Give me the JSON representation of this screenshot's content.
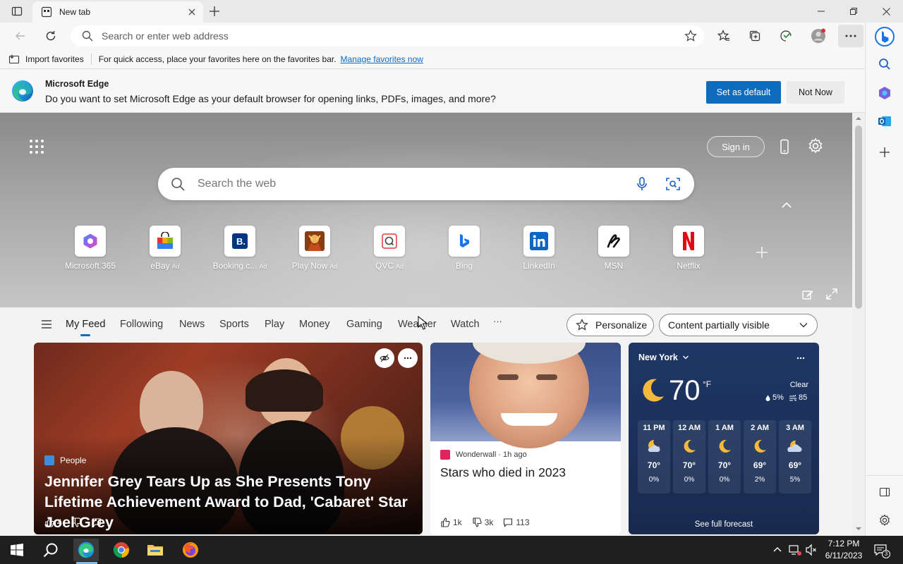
{
  "browser": {
    "tab_title": "New tab",
    "address_placeholder": "Search or enter web address",
    "favorites_bar": {
      "import_label": "Import favorites",
      "message": "For quick access, place your favorites here on the favorites bar.",
      "manage_link": "Manage favorites now"
    },
    "infobar": {
      "title": "Microsoft Edge",
      "message": "Do you want to set Microsoft Edge as your default browser for opening links, PDFs, images, and more?",
      "primary_button": "Set as default",
      "secondary_button": "Not Now"
    }
  },
  "ntp": {
    "signin_label": "Sign in",
    "search_placeholder": "Search the web",
    "quick_links": [
      {
        "label": "Microsoft 365",
        "ad": ""
      },
      {
        "label": "eBay",
        "ad": "Ad"
      },
      {
        "label": "Booking.c...",
        "ad": "Ad"
      },
      {
        "label": "Play Now",
        "ad": "Ad"
      },
      {
        "label": "QVC",
        "ad": "Ad"
      },
      {
        "label": "Bing",
        "ad": ""
      },
      {
        "label": "LinkedIn",
        "ad": ""
      },
      {
        "label": "MSN",
        "ad": ""
      },
      {
        "label": "Netflix",
        "ad": ""
      }
    ],
    "feed_nav": [
      "My Feed",
      "Following",
      "News",
      "Sports",
      "Play",
      "Money",
      "Gaming",
      "Weather",
      "Watch"
    ],
    "more_label": "···",
    "personalize_label": "Personalize",
    "content_visibility_label": "Content partially visible"
  },
  "cards": {
    "main": {
      "source": "People",
      "headline": "Jennifer Grey Tears Up as She Presents Tony Lifetime Achievement Award to Dad, 'Cabaret' Star Joel Grey",
      "likes": "4"
    },
    "second": {
      "source": "Wonderwall · 1h ago",
      "headline": "Stars who died in 2023",
      "likes": "1k",
      "dislikes": "3k",
      "comments": "113"
    }
  },
  "weather": {
    "city": "New York",
    "temp": "70",
    "unit": "°F",
    "condition": "Clear",
    "precip": "5%",
    "aqi": "85",
    "hours": [
      {
        "time": "11 PM",
        "temp": "70°",
        "precip": "0%",
        "icon": "partly-cloudy-night-icon"
      },
      {
        "time": "12 AM",
        "temp": "70°",
        "precip": "0%",
        "icon": "moon-icon"
      },
      {
        "time": "1 AM",
        "temp": "70°",
        "precip": "0%",
        "icon": "moon-icon"
      },
      {
        "time": "2 AM",
        "temp": "69°",
        "precip": "2%",
        "icon": "moon-icon"
      },
      {
        "time": "3 AM",
        "temp": "69°",
        "precip": "5%",
        "icon": "cloudy-night-icon"
      }
    ],
    "forecast_link": "See full forecast"
  },
  "taskbar": {
    "time": "7:12 PM",
    "date": "6/11/2023",
    "notification_count": "3"
  },
  "colors": {
    "accent": "#0f6cbd",
    "weather_bg": "#1f3766",
    "taskbar": "#1f1f1f"
  }
}
